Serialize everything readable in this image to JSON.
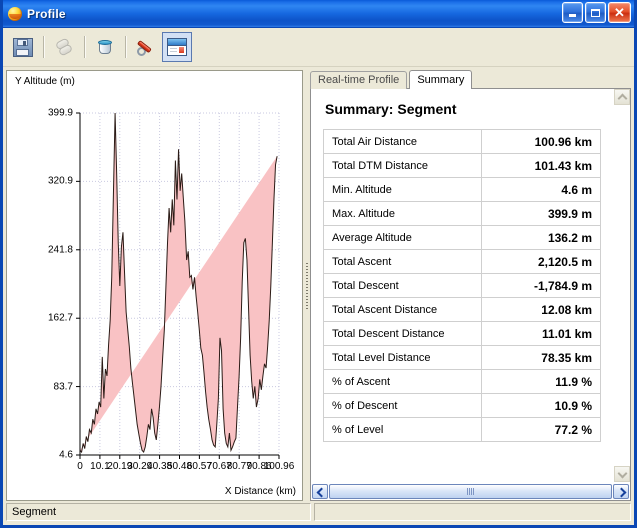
{
  "window": {
    "title": "Profile",
    "icon": "globe-icon",
    "buttons": {
      "minimize": "minimize-icon",
      "maximize": "maximize-icon",
      "close": "close-icon"
    }
  },
  "toolbar": {
    "items": [
      {
        "name": "save-button",
        "icon": "floppy-disk-icon",
        "enabled": true,
        "selected": false
      },
      {
        "name": "capsules-button",
        "icon": "capsules-icon",
        "enabled": false,
        "selected": false
      },
      {
        "name": "bucket-button",
        "icon": "paint-bucket-icon",
        "enabled": true,
        "selected": false
      },
      {
        "name": "tools-button",
        "icon": "wrench-pen-icon",
        "enabled": true,
        "selected": false
      },
      {
        "name": "layout-button",
        "icon": "window-layout-icon",
        "enabled": true,
        "selected": true
      }
    ]
  },
  "chart_panel": {
    "y_axis_title": "Y Altitude (m)",
    "x_axis_title": "X Distance (km)"
  },
  "right_panel": {
    "tabs": [
      {
        "label": "Real-time Profile",
        "active": false
      },
      {
        "label": "Summary",
        "active": true
      }
    ],
    "summary_title": "Summary: Segment",
    "table": {
      "rows": [
        {
          "key": "Total Air Distance",
          "value": "100.96 km"
        },
        {
          "key": "Total DTM Distance",
          "value": "101.43 km"
        },
        {
          "key": "Min. Altitude",
          "value": "4.6 m"
        },
        {
          "key": "Max. Altitude",
          "value": "399.9 m"
        },
        {
          "key": "Average Altitude",
          "value": "136.2 m"
        },
        {
          "key": "Total Ascent",
          "value": "2,120.5 m"
        },
        {
          "key": "Total Descent",
          "value": "-1,784.9 m"
        },
        {
          "key": "Total Ascent Distance",
          "value": "12.08 km"
        },
        {
          "key": "Total Descent Distance",
          "value": "11.01 km"
        },
        {
          "key": "Total Level Distance",
          "value": "78.35 km"
        },
        {
          "key": "% of Ascent",
          "value": "11.9 %"
        },
        {
          "key": "% of Descent",
          "value": "10.9 %"
        },
        {
          "key": "% of Level",
          "value": "77.2 %"
        }
      ]
    }
  },
  "statusbar": {
    "main": "Segment",
    "extra": ""
  },
  "colors": {
    "title_bar": "#1668e0",
    "window_border": "#0a47b4",
    "face": "#ece9d8",
    "close_button": "#cc2f10",
    "chart_fill": "#f9c2c4",
    "chart_line": "#2b1b16",
    "grid": "#c9c9e0",
    "tab_active_bg": "#ffffff"
  },
  "chart_data": {
    "type": "area",
    "title": "",
    "xlabel": "X Distance (km)",
    "ylabel": "Y Altitude (m)",
    "xlim": [
      0,
      100.96
    ],
    "ylim": [
      4.6,
      399.9
    ],
    "grid": true,
    "legend": null,
    "xticks": [
      0,
      10.1,
      20.19,
      30.29,
      40.38,
      50.48,
      60.57,
      70.67,
      80.77,
      90.86,
      100.96
    ],
    "xtick_labels": [
      "0",
      "10.1",
      "20.19",
      "30.29",
      "40.38",
      "50.48",
      "60.57",
      "70.67",
      "80.77",
      "90.86",
      "100.96"
    ],
    "yticks": [
      4.6,
      83.7,
      162.7,
      241.8,
      320.9,
      399.9
    ],
    "ytick_labels": [
      "4.6",
      "83.7",
      "162.7",
      "241.8",
      "320.9",
      "399.9"
    ],
    "series": [
      {
        "name": "Altitude profile",
        "fill": "#f9c2c4",
        "line": "#2b1b16",
        "x": [
          0.0,
          0.8,
          1.6,
          2.4,
          3.2,
          4.0,
          4.8,
          5.7,
          6.5,
          7.3,
          8.1,
          8.9,
          9.7,
          10.5,
          11.3,
          12.1,
          12.9,
          13.7,
          14.5,
          15.3,
          16.1,
          16.9,
          17.8,
          18.6,
          19.4,
          20.2,
          21.0,
          21.8,
          22.6,
          23.4,
          24.2,
          25.0,
          25.8,
          26.6,
          27.4,
          28.2,
          29.0,
          29.9,
          30.7,
          31.5,
          32.3,
          33.1,
          33.9,
          34.7,
          35.5,
          36.3,
          37.1,
          37.9,
          38.7,
          39.5,
          40.3,
          41.1,
          42.0,
          42.8,
          43.6,
          44.4,
          45.2,
          46.0,
          46.8,
          47.6,
          48.4,
          49.2,
          50.0,
          50.8,
          51.6,
          52.4,
          53.2,
          54.1,
          54.9,
          55.7,
          56.5,
          57.3,
          58.1,
          58.9,
          59.7,
          60.5,
          61.3,
          62.1,
          62.9,
          63.7,
          64.5,
          65.3,
          66.2,
          67.0,
          67.8,
          68.6,
          69.4,
          70.2,
          71.0,
          71.8,
          72.6,
          73.4,
          74.2,
          75.0,
          75.8,
          76.6,
          77.4,
          78.3,
          79.1,
          79.9,
          80.7,
          81.5,
          82.3,
          83.1,
          83.9,
          84.7,
          85.5,
          86.3,
          87.1,
          87.9,
          88.7,
          89.5,
          90.4,
          91.2,
          92.0,
          92.8,
          93.6,
          94.4,
          95.2,
          96.0,
          96.8,
          97.6,
          98.4,
          99.2,
          100.0,
          100.96
        ],
        "y": [
          10,
          8,
          18,
          12,
          26,
          20,
          34,
          30,
          46,
          40,
          58,
          52,
          66,
          60,
          118,
          70,
          104,
          96,
          132,
          160,
          210,
          300,
          399.9,
          330,
          250,
          200,
          245,
          262,
          215,
          170,
          150,
          130,
          105,
          88,
          72,
          56,
          40,
          28,
          18,
          10,
          8,
          14,
          26,
          40,
          34,
          58,
          48,
          30,
          22,
          40,
          60,
          84,
          120,
          150,
          200,
          250,
          290,
          262,
          300,
          270,
          345,
          300,
          358,
          310,
          330,
          302,
          275,
          230,
          240,
          210,
          212,
          196,
          210,
          188,
          170,
          150,
          128,
          120,
          100,
          78,
          60,
          46,
          34,
          22,
          16,
          14,
          40,
          70,
          140,
          125,
          58,
          30,
          18,
          14,
          30,
          10,
          14,
          20,
          24,
          60,
          95,
          140,
          205,
          250,
          255,
          230,
          175,
          120,
          90,
          70,
          84,
          60,
          70,
          92,
          80,
          96,
          110,
          105,
          130,
          160,
          200,
          250,
          300,
          340,
          350
        ]
      }
    ]
  }
}
